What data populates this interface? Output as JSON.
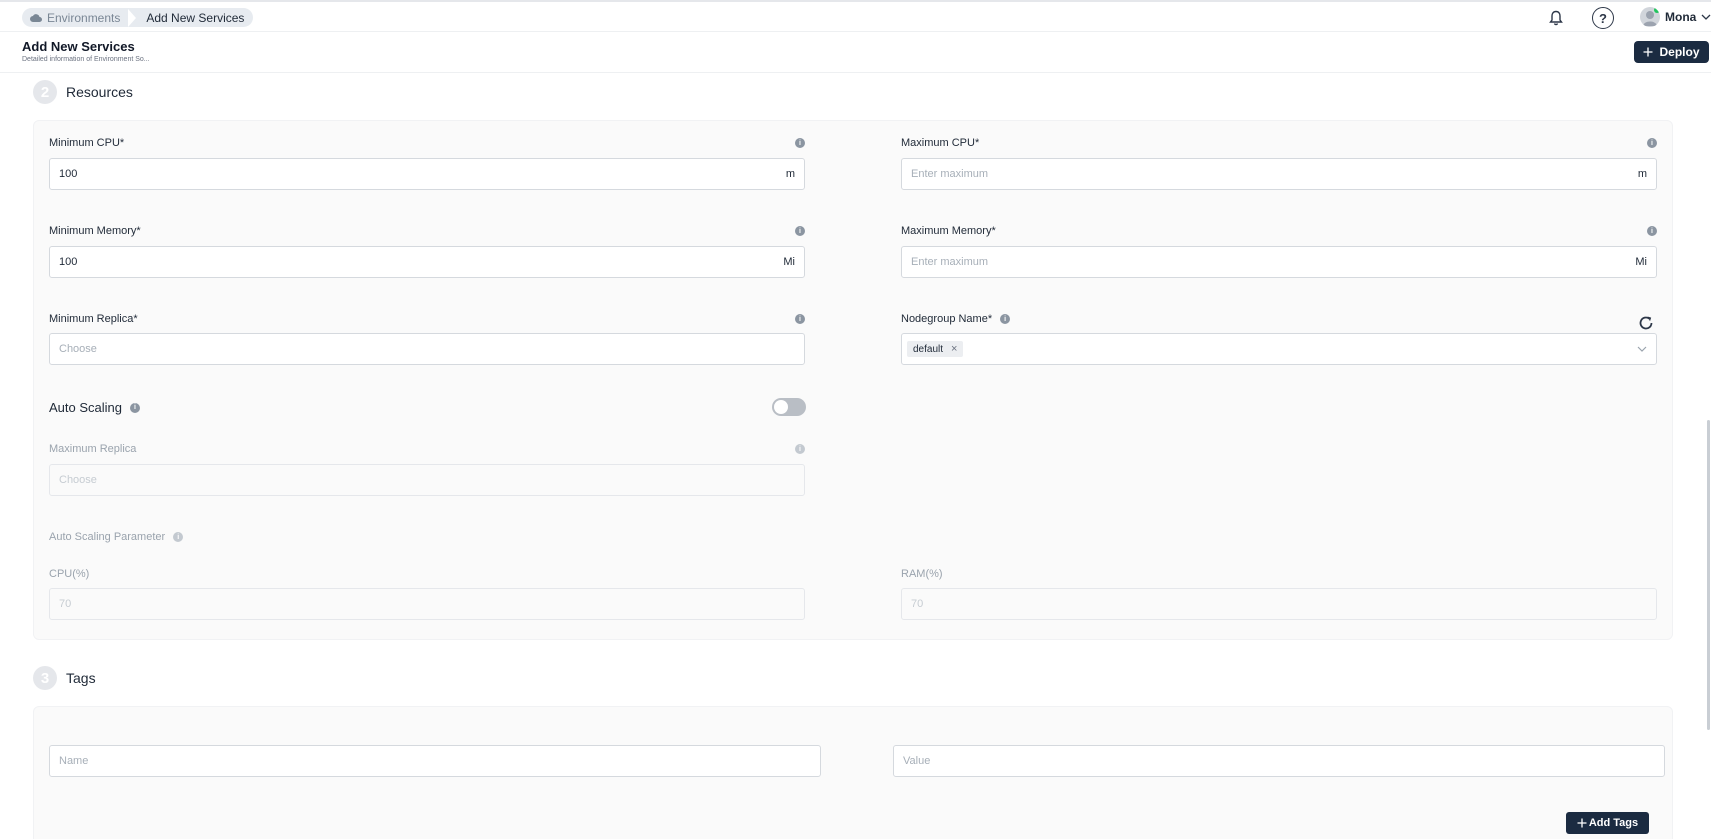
{
  "breadcrumb": {
    "items": [
      "Environments",
      "Add New Services"
    ]
  },
  "user": {
    "name": "Mona",
    "status_color": "#22c55e"
  },
  "help": {
    "glyph": "?"
  },
  "header": {
    "title": "Add New Services",
    "subtitle": "Detailed information of Environment So...",
    "deploy_label": "Deploy"
  },
  "resources": {
    "step": "2",
    "title": "Resources",
    "min_cpu": {
      "label": "Minimum CPU*",
      "value": "100",
      "unit": "m"
    },
    "max_cpu": {
      "label": "Maximum CPU*",
      "placeholder": "Enter maximum",
      "unit": "m"
    },
    "min_memory": {
      "label": "Minimum Memory*",
      "value": "100",
      "unit": "Mi"
    },
    "max_memory": {
      "label": "Maximum Memory*",
      "placeholder": "Enter maximum",
      "unit": "Mi"
    },
    "min_replica": {
      "label": "Minimum Replica*",
      "placeholder": "Choose"
    },
    "nodegroup": {
      "label": "Nodegroup Name*",
      "chip": "default"
    },
    "auto_scaling": {
      "label": "Auto Scaling",
      "enabled": false
    },
    "max_replica": {
      "label": "Maximum Replica",
      "placeholder": "Choose"
    },
    "parameter": {
      "label": "Auto Scaling Parameter"
    },
    "cpu_pct": {
      "label": "CPU(%)",
      "placeholder": "70"
    },
    "ram_pct": {
      "label": "RAM(%)",
      "placeholder": "70"
    }
  },
  "tags": {
    "step": "3",
    "title": "Tags",
    "name_placeholder": "Name",
    "value_placeholder": "Value",
    "add_label": "Add Tags"
  },
  "colors": {
    "primary": "#1b2b41",
    "breadcrumb_bg": "#e7ebf0"
  },
  "icons": [
    "cloud-icon",
    "bell-icon",
    "help-icon",
    "avatar",
    "chevron-down-icon",
    "plus-icon",
    "info-icon",
    "refresh-icon",
    "close-icon"
  ]
}
